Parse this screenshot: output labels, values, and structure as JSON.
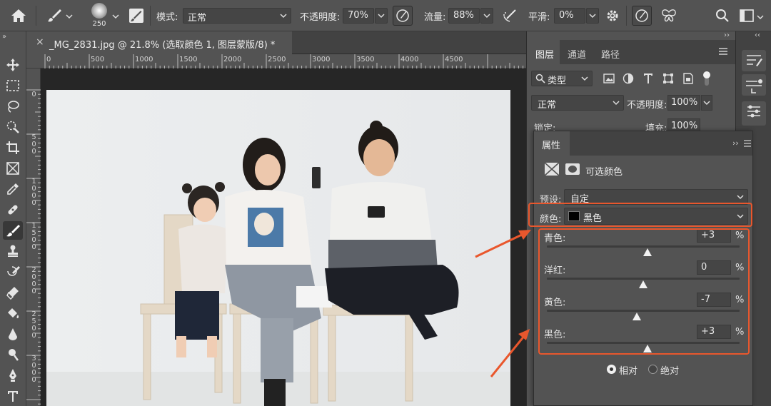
{
  "options_bar": {
    "brush_size": "250",
    "mode_label": "模式:",
    "mode_value": "正常",
    "opacity_label": "不透明度:",
    "opacity_value": "70%",
    "flow_label": "流量:",
    "flow_value": "88%",
    "smoothing_label": "平滑:",
    "smoothing_value": "0%"
  },
  "document": {
    "close_glyph": "×",
    "tab_title": "_MG_2831.jpg @ 21.8% (选取颜色 1, 图层蒙版/8) *",
    "ruler_h": [
      "0",
      "500",
      "1000",
      "1500",
      "2000",
      "2500",
      "3000",
      "3500",
      "4000",
      "4500"
    ],
    "ruler_v": [
      "0",
      "5\n0\n0",
      "1\n0\n0\n0",
      "1\n5\n0\n0",
      "2\n0\n0\n0",
      "2\n5\n0\n0",
      "3\n0\n0\n0"
    ]
  },
  "layers_panel": {
    "tabs": [
      "图层",
      "通道",
      "路径"
    ],
    "filter_label": "类型",
    "blend_mode": "正常",
    "opacity_label": "不透明度:",
    "opacity_value": "100%",
    "lock_label": "锁定:",
    "fill_label": "填充:",
    "fill_value": "100%"
  },
  "properties": {
    "title": "属性",
    "adjustment_name": "可选颜色",
    "preset_label": "预设:",
    "preset_value": "自定",
    "color_label": "颜色:",
    "color_value": "黑色",
    "sliders": [
      {
        "label": "青色:",
        "value": "+3",
        "pct": "%"
      },
      {
        "label": "洋红:",
        "value": "0",
        "pct": "%"
      },
      {
        "label": "黄色:",
        "value": "-7",
        "pct": "%"
      },
      {
        "label": "黑色:",
        "value": "+3",
        "pct": "%"
      }
    ],
    "method_relative": "相对",
    "method_absolute": "绝对"
  },
  "colors": {
    "annotation_orange": "#e9572d",
    "panel_bg": "#535353"
  }
}
